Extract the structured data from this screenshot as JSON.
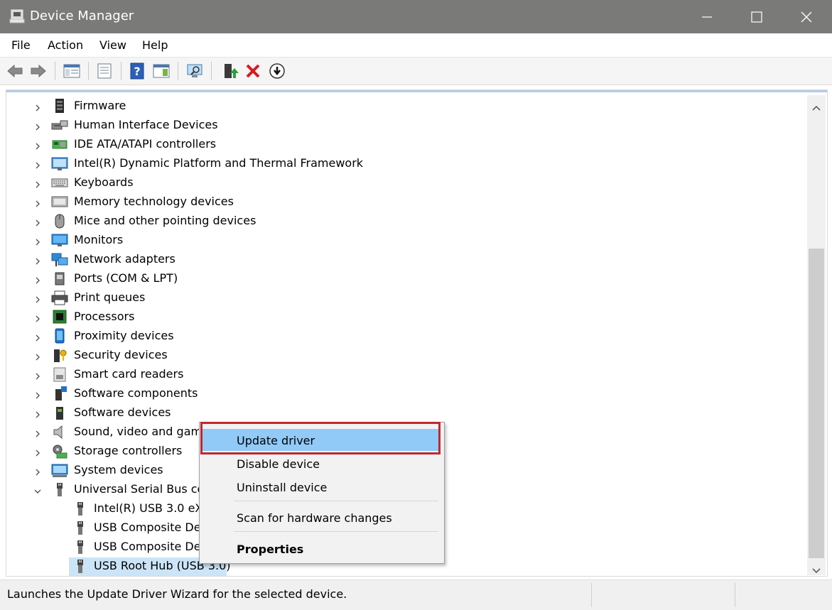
{
  "window": {
    "title": "Device Manager"
  },
  "menu": {
    "items": [
      "File",
      "Action",
      "View",
      "Help"
    ]
  },
  "toolbar": {
    "buttons": [
      "back-arrow-icon",
      "forward-arrow-icon",
      "show-hide-console-tree-icon",
      "properties-icon",
      "help-icon",
      "action-pane-icon",
      "scan-hardware-icon",
      "update-driver-icon",
      "uninstall-icon",
      "disable-icon"
    ]
  },
  "tree": {
    "categories": [
      "Firmware",
      "Human Interface Devices",
      "IDE ATA/ATAPI controllers",
      "Intel(R) Dynamic Platform and Thermal Framework",
      "Keyboards",
      "Memory technology devices",
      "Mice and other pointing devices",
      "Monitors",
      "Network adapters",
      "Ports (COM & LPT)",
      "Print queues",
      "Processors",
      "Proximity devices",
      "Security devices",
      "Smart card readers",
      "Software components",
      "Software devices",
      "Sound, video and game",
      "Storage controllers",
      "System devices",
      "Universal Serial Bus con"
    ],
    "usb_children": [
      "Intel(R) USB 3.0 eXte",
      "USB Composite Dev",
      "USB Composite Dev",
      "USB Root Hub (USB 3.0)"
    ],
    "selected": "USB Root Hub (USB 3.0)"
  },
  "context_menu": {
    "update_driver": "Update driver",
    "disable_device": "Disable device",
    "uninstall_device": "Uninstall device",
    "scan_hardware": "Scan for hardware changes",
    "properties": "Properties"
  },
  "status": {
    "text": "Launches the Update Driver Wizard for the selected device."
  },
  "colors": {
    "titlebar": "#7a7a78",
    "selection": "#cce4f7",
    "menu_highlight": "#91c9f7",
    "callout_red": "#c2272d"
  }
}
